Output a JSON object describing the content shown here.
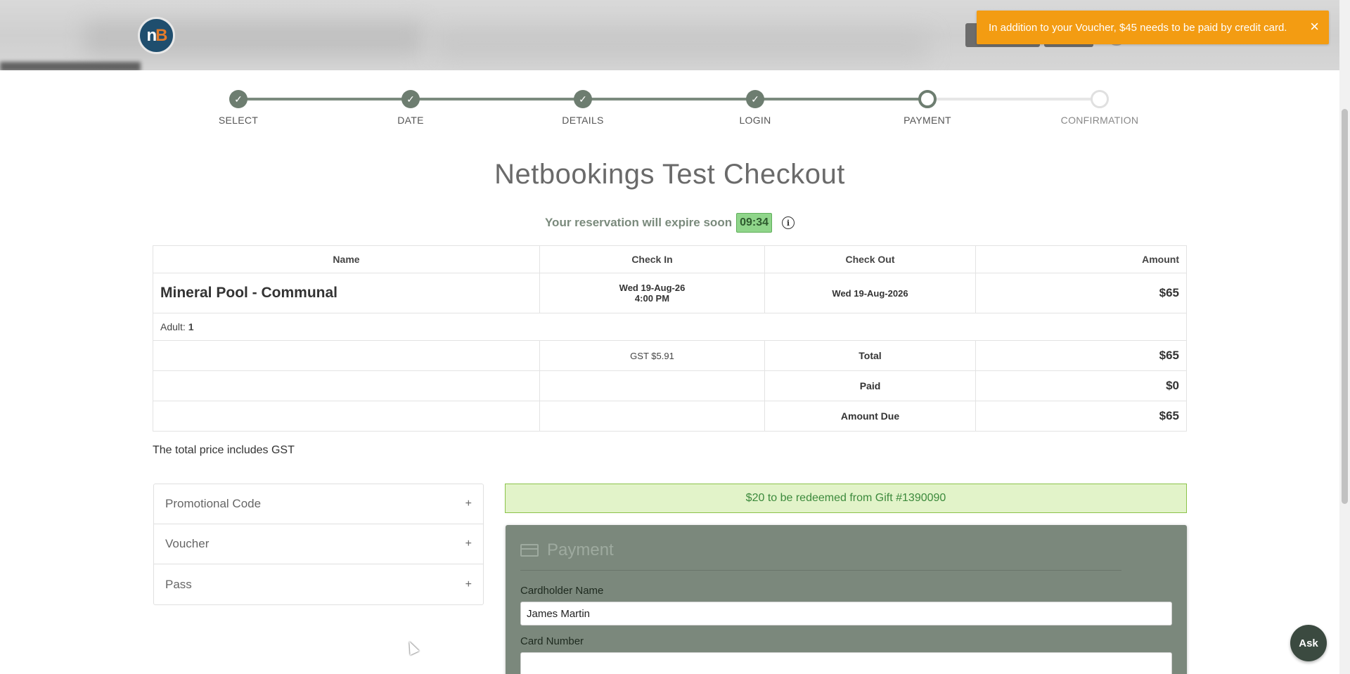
{
  "header": {
    "logo_text_n": "n",
    "logo_text_b": "B"
  },
  "toast": {
    "message": "In addition to your Voucher, $45 needs to be paid by credit card.",
    "close": "×"
  },
  "stepper": {
    "steps": [
      {
        "label": "SELECT",
        "state": "done"
      },
      {
        "label": "DATE",
        "state": "done"
      },
      {
        "label": "DETAILS",
        "state": "done"
      },
      {
        "label": "LOGIN",
        "state": "done"
      },
      {
        "label": "PAYMENT",
        "state": "current"
      },
      {
        "label": "CONFIRMATION",
        "state": "todo"
      }
    ]
  },
  "page": {
    "title": "Netbookings Test Checkout",
    "expiry_text": "Your reservation will expire soon",
    "timer": "09:34",
    "info_icon": "i"
  },
  "summary": {
    "headers": {
      "name": "Name",
      "check_in": "Check In",
      "check_out": "Check Out",
      "amount": "Amount"
    },
    "item": {
      "name": "Mineral Pool - Communal",
      "check_in_date": "Wed 19-Aug-26",
      "check_in_time": "4:00 PM",
      "check_out": "Wed 19-Aug-2026",
      "amount": "$65"
    },
    "adult_label": "Adult:",
    "adult_count": "1",
    "gst": "GST $5.91",
    "total_label": "Total",
    "total_value": "$65",
    "paid_label": "Paid",
    "paid_value": "$0",
    "due_label": "Amount Due",
    "due_value": "$65"
  },
  "gst_note": "The total price includes GST",
  "accordion": [
    {
      "label": "Promotional Code",
      "icon": "+"
    },
    {
      "label": "Voucher",
      "icon": "+"
    },
    {
      "label": "Pass",
      "icon": "+"
    }
  ],
  "redeem_banner": "$20 to be redeemed from Gift #1390090",
  "payment": {
    "title": "Payment",
    "cardholder_label": "Cardholder Name",
    "cardholder_value": "James Martin",
    "card_number_label": "Card Number",
    "card_number_value": ""
  },
  "ask_button": "Ask",
  "colors": {
    "toast": "#f39c12",
    "step_done": "#6d7d70",
    "timer_bg": "#8fd58a",
    "redeem_bg": "#e2f3c9",
    "payment_panel": "#7b887c",
    "ask_button": "#3b4a40"
  }
}
